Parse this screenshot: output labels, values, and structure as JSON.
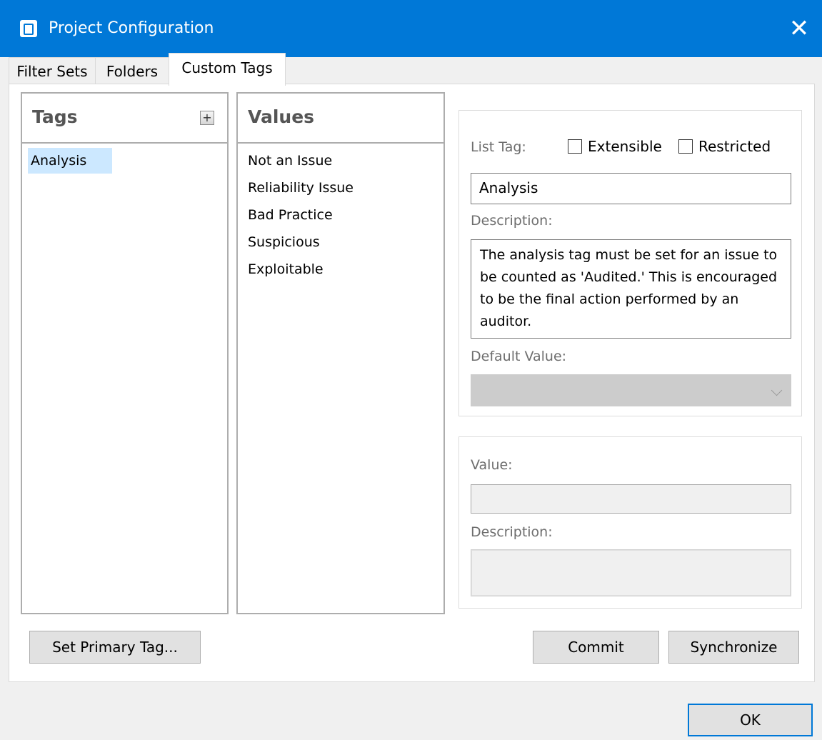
{
  "window": {
    "title": "Project Configuration",
    "close_glyph": "✕",
    "icon": "app-icon"
  },
  "tabs": [
    {
      "label": "Filter Sets"
    },
    {
      "label": "Folders"
    },
    {
      "label": "Custom Tags",
      "active": true
    }
  ],
  "tags_panel": {
    "title": "Tags",
    "add_glyph": "+",
    "items": [
      {
        "label": "Analysis",
        "selected": true
      }
    ]
  },
  "values_panel": {
    "title": "Values",
    "items": [
      {
        "label": "Not an Issue"
      },
      {
        "label": "Reliability Issue"
      },
      {
        "label": "Bad Practice"
      },
      {
        "label": "Suspicious"
      },
      {
        "label": "Exploitable"
      }
    ]
  },
  "tag_details": {
    "list_tag_label": "List Tag:",
    "extensible_label": "Extensible",
    "extensible_checked": false,
    "restricted_label": "Restricted",
    "restricted_checked": false,
    "name_value": "Analysis",
    "description_label": "Description:",
    "description_value": "The analysis tag must be set for an issue to be counted as 'Audited.' This is encouraged to be the final action performed by an auditor.",
    "default_value_label": "Default Value:",
    "default_value": ""
  },
  "value_details": {
    "value_label": "Value:",
    "value": "",
    "description_label": "Description:",
    "description_value": ""
  },
  "buttons": {
    "set_primary": "Set Primary Tag...",
    "commit": "Commit",
    "synchronize": "Synchronize",
    "ok": "OK"
  },
  "colors": {
    "titlebar": "#0078d7",
    "selection": "#cce8ff",
    "default_button_border": "#0078d7"
  }
}
